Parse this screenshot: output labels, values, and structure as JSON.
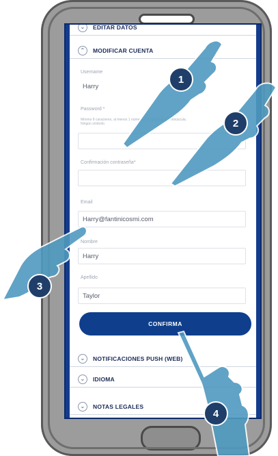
{
  "account_section": {
    "title": "MODIFICAR CUENTA",
    "partial_title": "EDITAR DATOS"
  },
  "form": {
    "username_label": "Username",
    "username_value": "Harry",
    "password_label": "Password *",
    "password_hint": "Mínimo 8 caracteres, al menos 1 número, 1 mayúscula y 1 minúscula. Ningún símbolo.",
    "confirm_password_label": "Confirmación contraseña*",
    "email_label": "Email",
    "email_value": "Harry@fantinicosmi.com",
    "name_label": "Nombre",
    "name_value": "Harry",
    "surname_label": "Apellido",
    "surname_value": "Taylor",
    "confirm_button": "CONFIRMA"
  },
  "sections": {
    "push": "NOTIFICACIONES PUSH (WEB)",
    "language": "IDIOMA",
    "legal": "NOTAS LEGALES"
  },
  "steps": [
    "1",
    "2",
    "3",
    "4"
  ],
  "colors": {
    "primary": "#0f3f8c",
    "hand": "#4f9ac0",
    "badge": "#1f3f6a"
  }
}
